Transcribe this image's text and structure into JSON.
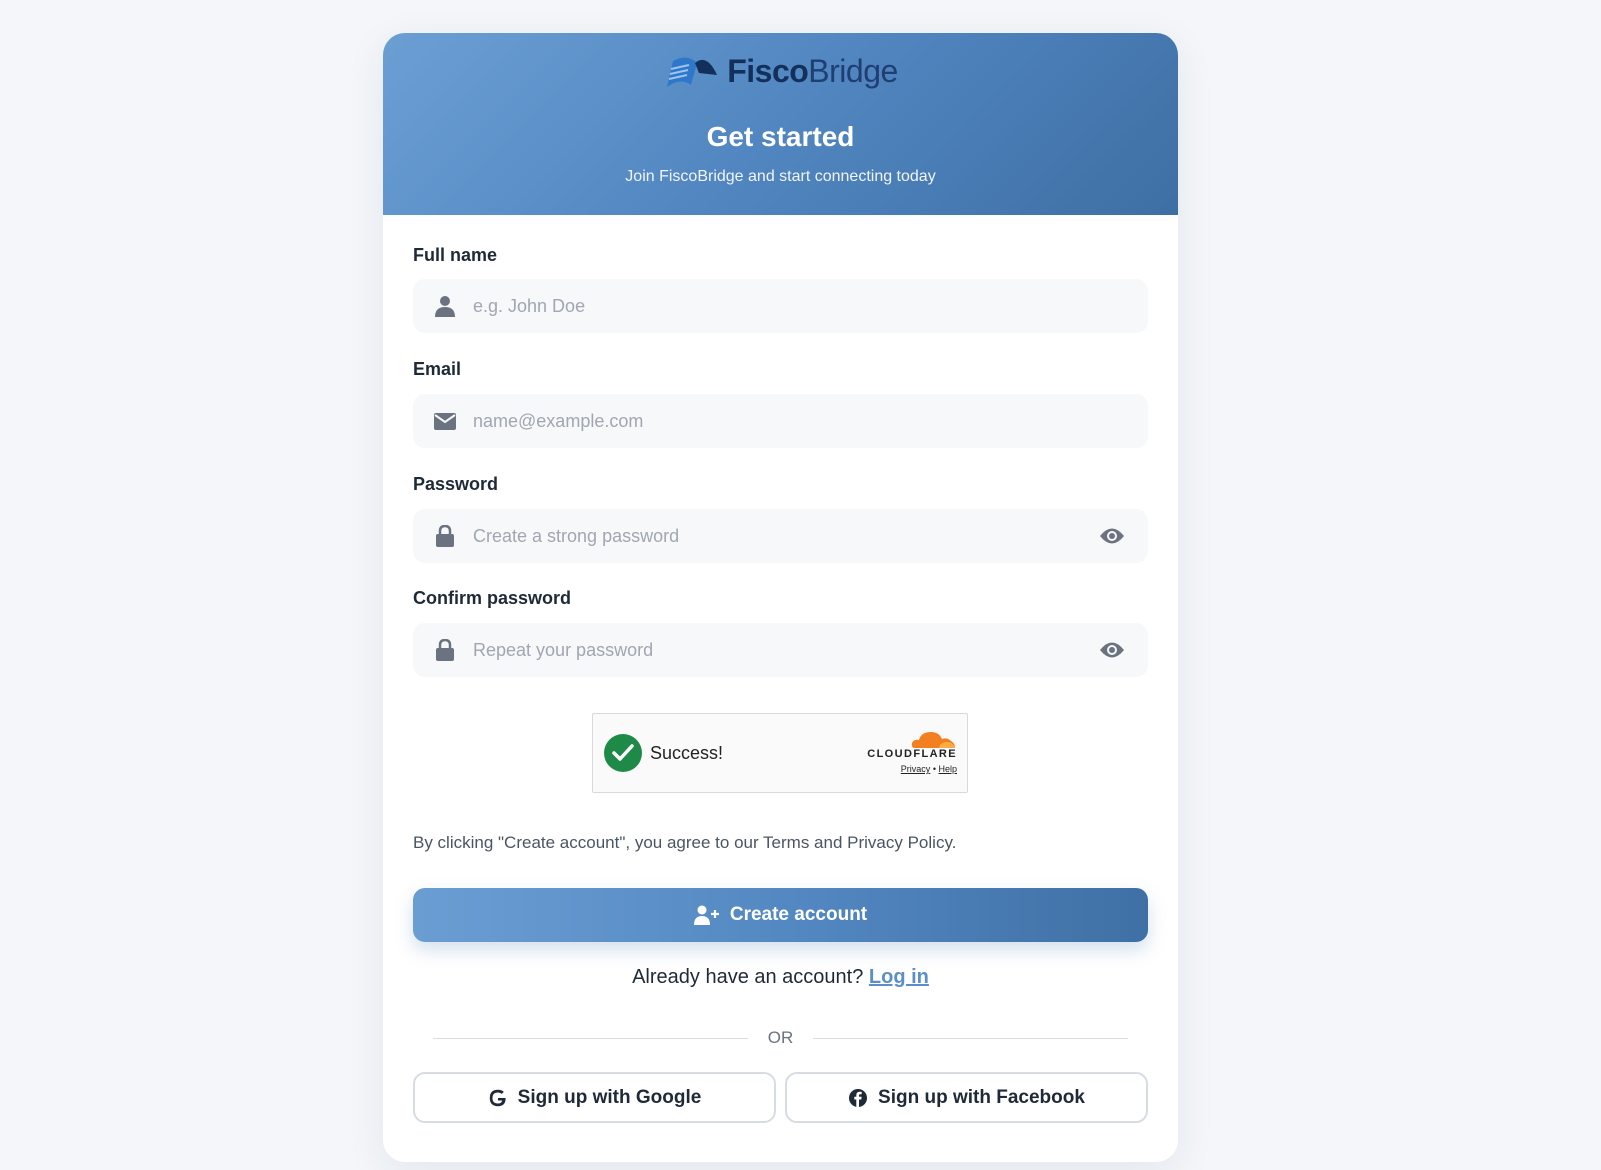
{
  "brand": {
    "name_bold": "Fisco",
    "name_regular": "Bridge"
  },
  "hero": {
    "title": "Get started",
    "subtitle": "Join FiscoBridge and start connecting today"
  },
  "fields": {
    "full_name": {
      "label": "Full name",
      "placeholder": "e.g. John Doe",
      "value": ""
    },
    "email": {
      "label": "Email",
      "placeholder": "name@example.com",
      "value": ""
    },
    "password": {
      "label": "Password",
      "placeholder": "Create a strong password",
      "value": ""
    },
    "confirm_password": {
      "label": "Confirm password",
      "placeholder": "Repeat your password",
      "value": ""
    }
  },
  "captcha": {
    "status": "Success!",
    "provider": "CLOUDFLARE",
    "privacy_link": "Privacy",
    "separator": "•",
    "help_link": "Help"
  },
  "terms_text": "By clicking \"Create account\", you agree to our Terms and Privacy Policy.",
  "create_button": "Create account",
  "login_prompt": {
    "text": "Already have an account?",
    "link": "Log in"
  },
  "divider_text": "OR",
  "social": {
    "google": "Sign up with Google",
    "facebook": "Sign up with Facebook"
  },
  "colors": {
    "accent": "#5186c0",
    "success": "#1e8a47",
    "cloudflare_orange": "#f38020"
  },
  "icons": {
    "full_name": "user-icon",
    "email": "envelope-icon",
    "password": "lock-icon",
    "toggle": "eye-icon",
    "create": "user-plus-icon",
    "google": "google-icon",
    "facebook": "facebook-icon"
  }
}
